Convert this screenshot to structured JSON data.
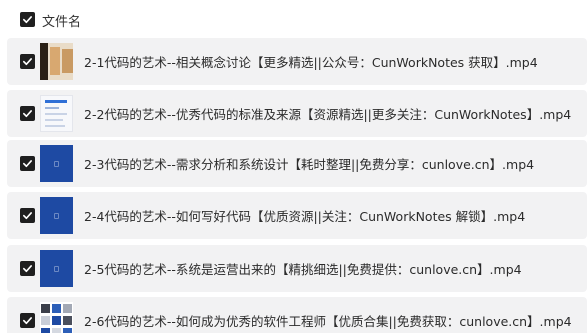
{
  "header": {
    "column_label": "文件名"
  },
  "files": [
    {
      "name": "2-1代码的艺术--相关概念讨论【更多精选||公众号：CunWorkNotes 获取】.mp4",
      "thumb": "photo"
    },
    {
      "name": "2-2代码的艺术--优秀代码的标准及来源【资源精选||更多关注：CunWorkNotes】.mp4",
      "thumb": "doc"
    },
    {
      "name": "2-3代码的艺术--需求分析和系统设计【耗时整理||免费分享：cunlove.cn】.mp4",
      "thumb": "blue"
    },
    {
      "name": "2-4代码的艺术--如何写好代码【优质资源||关注：CunWorkNotes 解锁】.mp4",
      "thumb": "blue"
    },
    {
      "name": "2-5代码的艺术--系统是运营出来的【精挑细选||免费提供：cunlove.cn】.mp4",
      "thumb": "blue"
    },
    {
      "name": "2-6代码的艺术--如何成为优秀的软件工程师【优质合集||免费获取：cunlove.cn】.mp4",
      "thumb": "grid"
    }
  ],
  "colors": {
    "row_bg": "#f2f2f3",
    "checkbox": "#1f1f1f",
    "video_thumb_blue": "#1e4aa3"
  },
  "icons": {
    "checkbox": "checkmark-icon"
  }
}
